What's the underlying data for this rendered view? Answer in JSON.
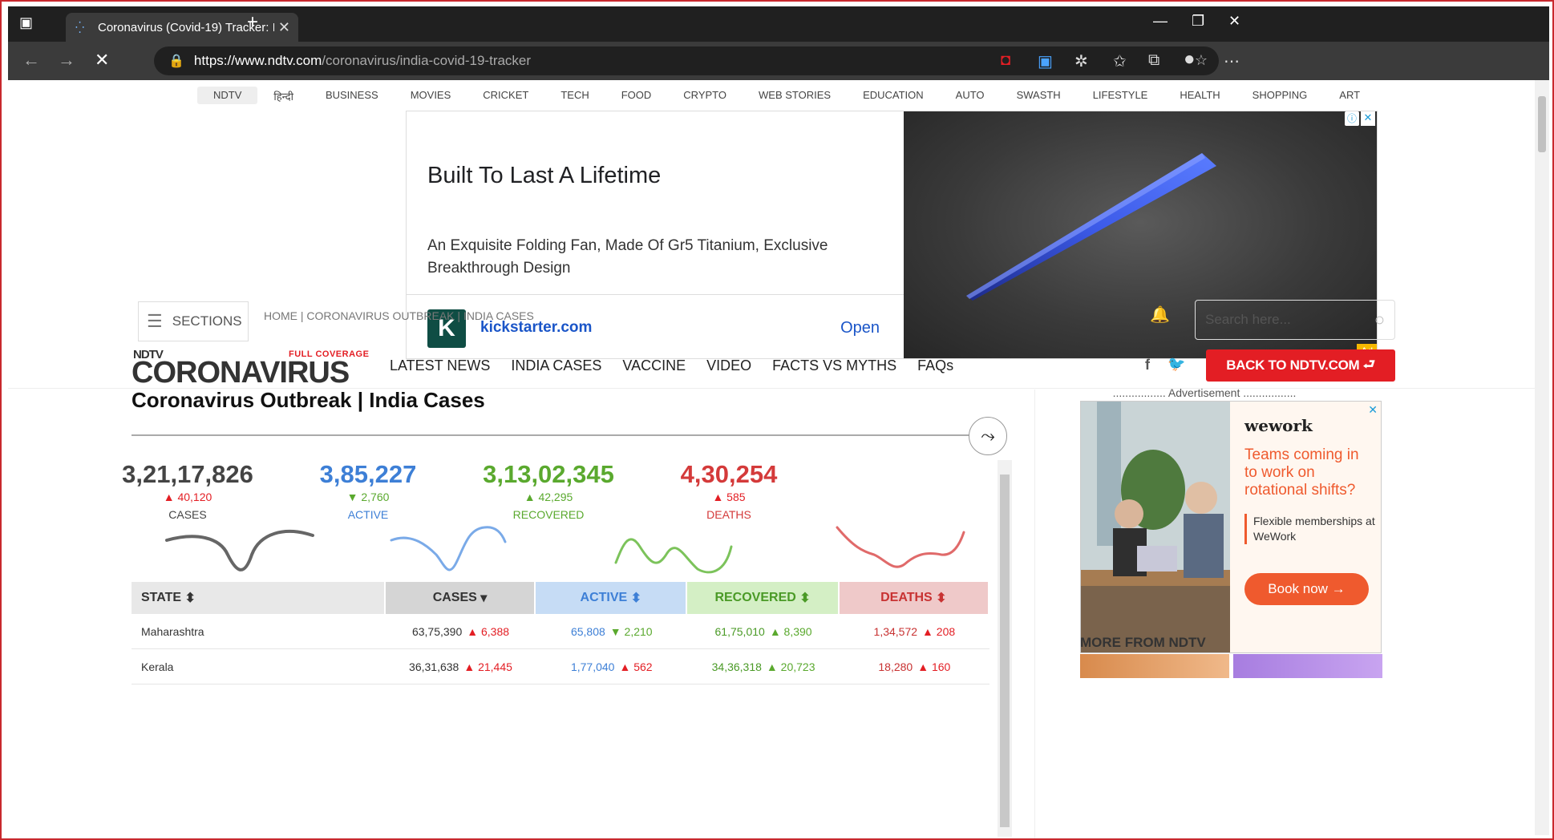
{
  "browser": {
    "tab_title": "Coronavirus (Covid-19) Tracker: I",
    "url_host": "https://www.ndtv.com",
    "url_path": "/coronavirus/india-covid-19-tracker"
  },
  "topnav": [
    "NDTV",
    "हिन्दी",
    "BUSINESS",
    "MOVIES",
    "CRICKET",
    "TECH",
    "FOOD",
    "CRYPTO",
    "WEB STORIES",
    "EDUCATION",
    "AUTO",
    "SWASTH",
    "LIFESTYLE",
    "HEALTH",
    "SHOPPING",
    "ART"
  ],
  "ad": {
    "headline": "Built To Last A Lifetime",
    "description": "An Exquisite Folding Fan, Made Of Gr5 Titanium, Exclusive Breakthrough Design",
    "domain": "kickstarter.com",
    "cta": "Open",
    "badge": "Ad"
  },
  "header": {
    "sections_label": "SECTIONS",
    "breadcrumb": "HOME  |  CORONAVIRUS OUTBREAK  |  INDIA CASES",
    "search_placeholder": "Search here...",
    "logo_top": "NDTV",
    "logo_main": "CORONAVIRUS",
    "logo_tag": "FULL COVERAGE",
    "mainnav": [
      "LATEST NEWS",
      "INDIA CASES",
      "VACCINE",
      "VIDEO",
      "FACTS VS MYTHS",
      "FAQs"
    ],
    "back_button": "BACK TO NDTV.COM"
  },
  "main": {
    "title": "Coronavirus Outbreak | India Cases",
    "stats": [
      {
        "value": "3,21,17,826",
        "delta": "▲ 40,120",
        "label": "CASES",
        "color": "#444444",
        "delta_color": "#e31e24"
      },
      {
        "value": "3,85,227",
        "delta": "▼ 2,760",
        "label": "ACTIVE",
        "color": "#3d7fd6",
        "delta_color": "#5aa92e"
      },
      {
        "value": "3,13,02,345",
        "delta": "▲ 42,295",
        "label": "RECOVERED",
        "color": "#5aa92e",
        "delta_color": "#5aa92e"
      },
      {
        "value": "4,30,254",
        "delta": "▲ 585",
        "label": "DEATHS",
        "color": "#d43a3a",
        "delta_color": "#e31e24"
      }
    ],
    "table": {
      "headers": [
        "STATE",
        "CASES",
        "ACTIVE",
        "RECOVERED",
        "DEATHS"
      ],
      "rows": [
        {
          "state": "Maharashtra",
          "cases": "63,75,390",
          "cases_d": "▲ 6,388",
          "active": "65,808",
          "active_d": "▼ 2,210",
          "rec": "61,75,010",
          "rec_d": "▲ 8,390",
          "deaths": "1,34,572",
          "deaths_d": "▲ 208"
        },
        {
          "state": "Kerala",
          "cases": "36,31,638",
          "cases_d": "▲ 21,445",
          "active": "1,77,040",
          "active_d": "▲ 562",
          "rec": "34,36,318",
          "rec_d": "▲ 20,723",
          "deaths": "18,280",
          "deaths_d": "▲ 160"
        }
      ]
    }
  },
  "sidebar": {
    "ad_label": "................. Advertisement .................",
    "wework_logo": "wework",
    "wework_head": "Teams coming in to work on rotational shifts?",
    "wework_sub": "Flexible memberships at WeWork",
    "wework_cta": "Book now →",
    "more_title": "MORE FROM NDTV"
  }
}
